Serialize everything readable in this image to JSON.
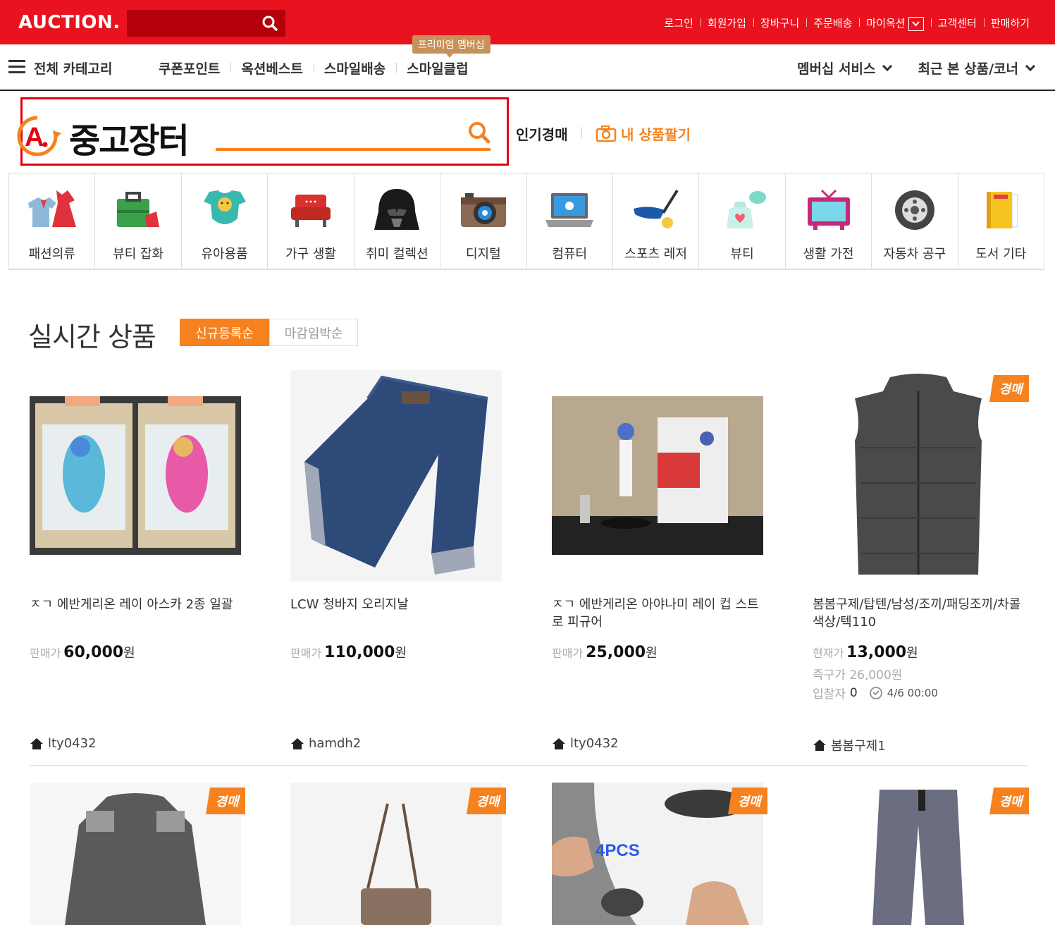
{
  "topbar": {
    "logo": "AUCTION.",
    "links": [
      "로그인",
      "회원가입",
      "장바구니",
      "주문배송",
      "마이옥션",
      "고객센터",
      "판매하기"
    ]
  },
  "gnb": {
    "all_category": "전체 카테고리",
    "menu": [
      "쿠폰포인트",
      "옥션베스트",
      "스마일배송",
      "스마일클럽"
    ],
    "premium_tag": "프리미엄 멤버십",
    "right": [
      "멤버십 서비스",
      "최근 본 상품/코너"
    ]
  },
  "used_market": {
    "title": "중고장터",
    "search_value": "",
    "hot_auction": "인기경매",
    "sell_mine": "내 상품팔기"
  },
  "categories": [
    {
      "label": "패션의류",
      "icon": "clothes-icon"
    },
    {
      "label": "뷰티 잡화",
      "icon": "bag-icon"
    },
    {
      "label": "유아용품",
      "icon": "baby-onesie-icon"
    },
    {
      "label": "가구 생활",
      "icon": "sofa-icon"
    },
    {
      "label": "취미 컬렉션",
      "icon": "darth-vader-icon"
    },
    {
      "label": "디지털",
      "icon": "camera-icon"
    },
    {
      "label": "컴퓨터",
      "icon": "laptop-icon"
    },
    {
      "label": "스포츠 레저",
      "icon": "golf-icon"
    },
    {
      "label": "뷰티",
      "icon": "perfume-icon"
    },
    {
      "label": "생활 가전",
      "icon": "tv-icon"
    },
    {
      "label": "자동차 공구",
      "icon": "tire-icon"
    },
    {
      "label": "도서 기타",
      "icon": "book-icon"
    }
  ],
  "realtime": {
    "title": "실시간 상품",
    "tab_new": "신규등록순",
    "tab_closing": "마감임박순"
  },
  "products": [
    {
      "name": "ㅈㄱ 에반게리온 레이 아스카 2종 일괄",
      "price_label": "판매가",
      "price": "60,000",
      "unit": "원",
      "seller": "lty0432"
    },
    {
      "name": "LCW 청바지 오리지날",
      "price_label": "판매가",
      "price": "110,000",
      "unit": "원",
      "seller": "hamdh2"
    },
    {
      "name": "ㅈㄱ 에반게리온 아야나미 레이 컵 스트로 피규어",
      "price_label": "판매가",
      "price": "25,000",
      "unit": "원",
      "seller": "lty0432"
    },
    {
      "name": "봄봄구제/탑텐/남성/조끼/패딩조끼/차콜색상/텍110",
      "price_label": "현재가",
      "price": "13,000",
      "unit": "원",
      "instant_label": "즉구가",
      "instant_price": "26,000원",
      "bidders_label": "입찰자",
      "bidders": "0",
      "deadline": "4/6 00:00",
      "seller": "봄봄구제1",
      "badge": "경매"
    }
  ],
  "second_row_badges": [
    "경매",
    "경매",
    "경매",
    "경매"
  ],
  "second_row_overlay_text": "4PCS",
  "colors": {
    "brand_red": "#e8131e",
    "accent_orange": "#f5821f"
  }
}
